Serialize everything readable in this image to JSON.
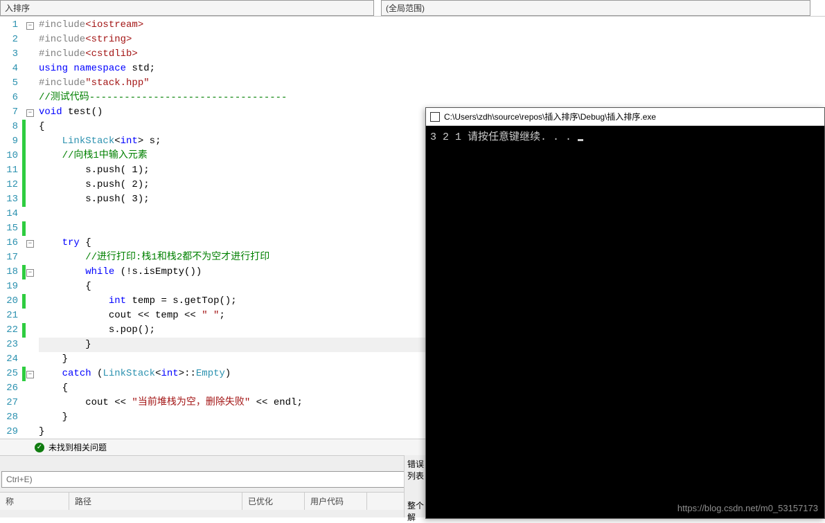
{
  "top": {
    "left_dropdown": "入排序",
    "right_dropdown": "(全局范围)"
  },
  "code": {
    "lines": [
      {
        "n": 1,
        "fold": "-",
        "mark": false,
        "html": "<span class='inc'>#include</span><span class='str'>&lt;iostream&gt;</span>"
      },
      {
        "n": 2,
        "fold": "",
        "mark": false,
        "html": "<span class='inc'>#include</span><span class='str'>&lt;string&gt;</span>"
      },
      {
        "n": 3,
        "fold": "",
        "mark": false,
        "html": "<span class='inc'>#include</span><span class='str'>&lt;cstdlib&gt;</span>"
      },
      {
        "n": 4,
        "fold": "",
        "mark": false,
        "html": "<span class='kw'>using</span> <span class='kw'>namespace</span> std;"
      },
      {
        "n": 5,
        "fold": "",
        "mark": false,
        "html": "<span class='inc'>#include</span><span class='str'>\"stack.hpp\"</span>"
      },
      {
        "n": 6,
        "fold": "",
        "mark": false,
        "html": "<span class='cmt'>//测试代码----------------------------------</span>"
      },
      {
        "n": 7,
        "fold": "-",
        "mark": false,
        "html": "<span class='kw'>void</span> test()"
      },
      {
        "n": 8,
        "fold": "",
        "mark": true,
        "html": "{"
      },
      {
        "n": 9,
        "fold": "",
        "mark": true,
        "html": "    <span class='type'>LinkStack</span>&lt;<span class='kw'>int</span>&gt; s;"
      },
      {
        "n": 10,
        "fold": "",
        "mark": true,
        "html": "    <span class='cmt'>//向栈1中输入元素</span>"
      },
      {
        "n": 11,
        "fold": "",
        "mark": true,
        "html": "        s.push( 1);"
      },
      {
        "n": 12,
        "fold": "",
        "mark": true,
        "html": "        s.push( 2);"
      },
      {
        "n": 13,
        "fold": "",
        "mark": true,
        "html": "        s.push( 3);"
      },
      {
        "n": 14,
        "fold": "",
        "mark": false,
        "html": ""
      },
      {
        "n": 15,
        "fold": "",
        "mark": true,
        "html": ""
      },
      {
        "n": 16,
        "fold": "-",
        "mark": false,
        "html": "    <span class='kw'>try</span> {"
      },
      {
        "n": 17,
        "fold": "",
        "mark": false,
        "html": "        <span class='cmt'>//进行打印:栈1和栈2都不为空才进行打印</span>"
      },
      {
        "n": 18,
        "fold": "-",
        "mark": true,
        "html": "        <span class='kw'>while</span> (!s.isEmpty())"
      },
      {
        "n": 19,
        "fold": "",
        "mark": false,
        "html": "        {"
      },
      {
        "n": 20,
        "fold": "",
        "mark": true,
        "html": "            <span class='kw'>int</span> temp = s.getTop();"
      },
      {
        "n": 21,
        "fold": "",
        "mark": false,
        "html": "            cout &lt;&lt; temp &lt;&lt; <span class='str'>\" \"</span>;"
      },
      {
        "n": 22,
        "fold": "",
        "mark": true,
        "html": "            s.pop();"
      },
      {
        "n": 23,
        "fold": "",
        "mark": false,
        "hl": true,
        "html": "        }"
      },
      {
        "n": 24,
        "fold": "",
        "mark": false,
        "html": "    }"
      },
      {
        "n": 25,
        "fold": "-",
        "mark": true,
        "html": "    <span class='kw'>catch</span> (<span class='type'>LinkStack</span>&lt;<span class='kw'>int</span>&gt;::<span class='type'>Empty</span>)"
      },
      {
        "n": 26,
        "fold": "",
        "mark": false,
        "html": "    {"
      },
      {
        "n": 27,
        "fold": "",
        "mark": false,
        "html": "        cout &lt;&lt; <span class='str'>\"当前堆栈为空，删除失败\"</span> &lt;&lt; endl;"
      },
      {
        "n": 28,
        "fold": "",
        "mark": false,
        "html": "    }"
      },
      {
        "n": 29,
        "fold": "",
        "mark": false,
        "html": "}"
      }
    ]
  },
  "console": {
    "title": "C:\\Users\\zdh\\source\\repos\\插入排序\\Debug\\插入排序.exe",
    "output": "3 2 1 请按任意键继续. . . "
  },
  "status": {
    "text": "未找到相关问题"
  },
  "bottom": {
    "search_placeholder": "Ctrl+E)",
    "cols": {
      "c1": "称",
      "c2": "路径",
      "c3": "已优化",
      "c4": "用户代码"
    },
    "error_tab": "错误列表",
    "error_sub": "整个解"
  },
  "watermark": "https://blog.csdn.net/m0_53157173"
}
